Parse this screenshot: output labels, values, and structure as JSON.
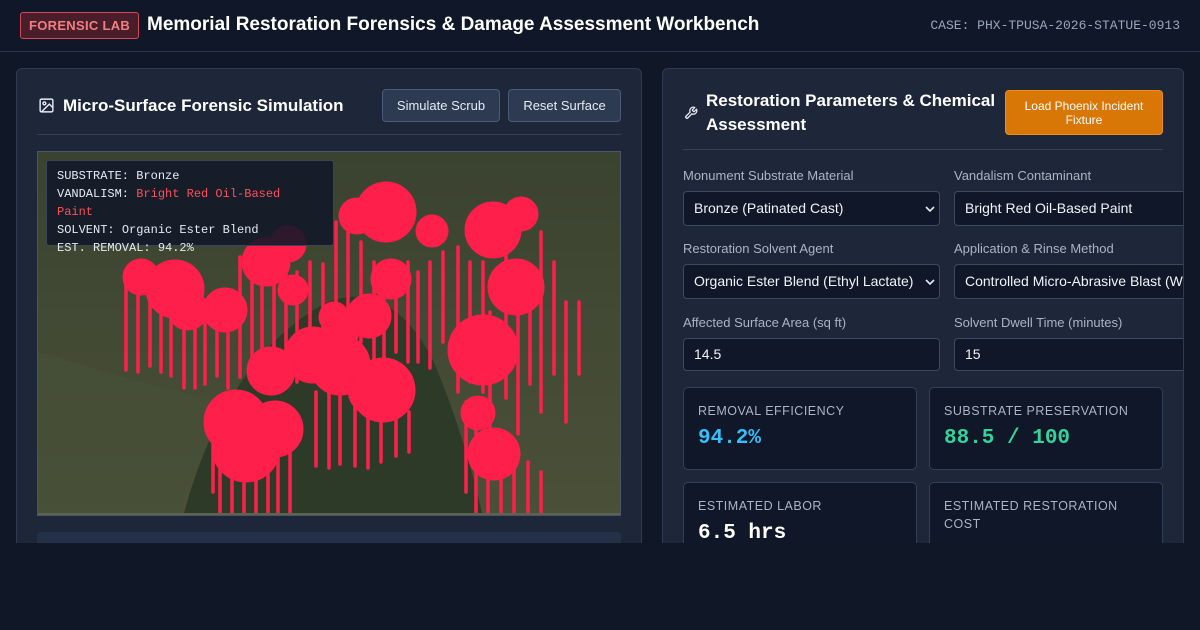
{
  "header": {
    "badge": "FORENSIC LAB",
    "title": "Memorial Restoration Forensics & Damage Assessment Workbench",
    "case_id": "CASE: PHX-TPUSA-2026-STATUE-0913"
  },
  "left_panel": {
    "title": "Micro-Surface Forensic Simulation",
    "simulate_button": "Simulate Scrub",
    "reset_button": "Reset Surface",
    "overlay": {
      "substrate_key": "SUBSTRATE:",
      "substrate_value": "Bronze",
      "vandalism_key": "VANDALISM:",
      "vandalism_value": "Bright Red Oil-Based Paint",
      "solvent_key": "SOLVENT:",
      "solvent_value": "Organic Ester Blend",
      "removal_key": "EST. REMOVAL:",
      "removal_value": "94.2%"
    }
  },
  "right_panel": {
    "title_line1": "Restoration Parameters & Chemical",
    "title_line2": "Assessment",
    "load_button_line1": "Load Phoenix Incident",
    "load_button_line2": "Fixture",
    "fields": {
      "substrate_label": "Monument Substrate Material",
      "substrate_value": "Bronze (Patinated Cast)",
      "contaminant_label": "Vandalism Contaminant",
      "contaminant_value": "Bright Red Oil-Based Paint",
      "solvent_label": "Restoration Solvent Agent",
      "solvent_value": "Organic Ester Blend (Ethyl Lactate)",
      "method_label": "Application & Rinse Method",
      "method_value": "Controlled Micro-Abrasive Blast (Walnut Shell)",
      "area_label": "Affected Surface Area (sq ft)",
      "area_value": "14.5",
      "dwell_label": "Solvent Dwell Time (minutes)",
      "dwell_value": "15"
    },
    "stats": {
      "efficiency_label": "REMOVAL EFFICIENCY",
      "efficiency_value": "94.2%",
      "preservation_label": "SUBSTRATE PRESERVATION",
      "preservation_value": "88.5 / 100",
      "labor_label": "ESTIMATED LABOR",
      "labor_value": "6.5 hrs",
      "cost_label_line1": "ESTIMATED RESTORATION",
      "cost_label_line2": "COST"
    }
  },
  "colors": {
    "accent_orange": "#d97706",
    "paint_red": "#ff1f4b",
    "efficiency_blue": "#38bdf8",
    "preservation_green": "#34d399"
  },
  "icons": [
    "image-icon",
    "wrench-icon",
    "chevron-down-icon"
  ]
}
